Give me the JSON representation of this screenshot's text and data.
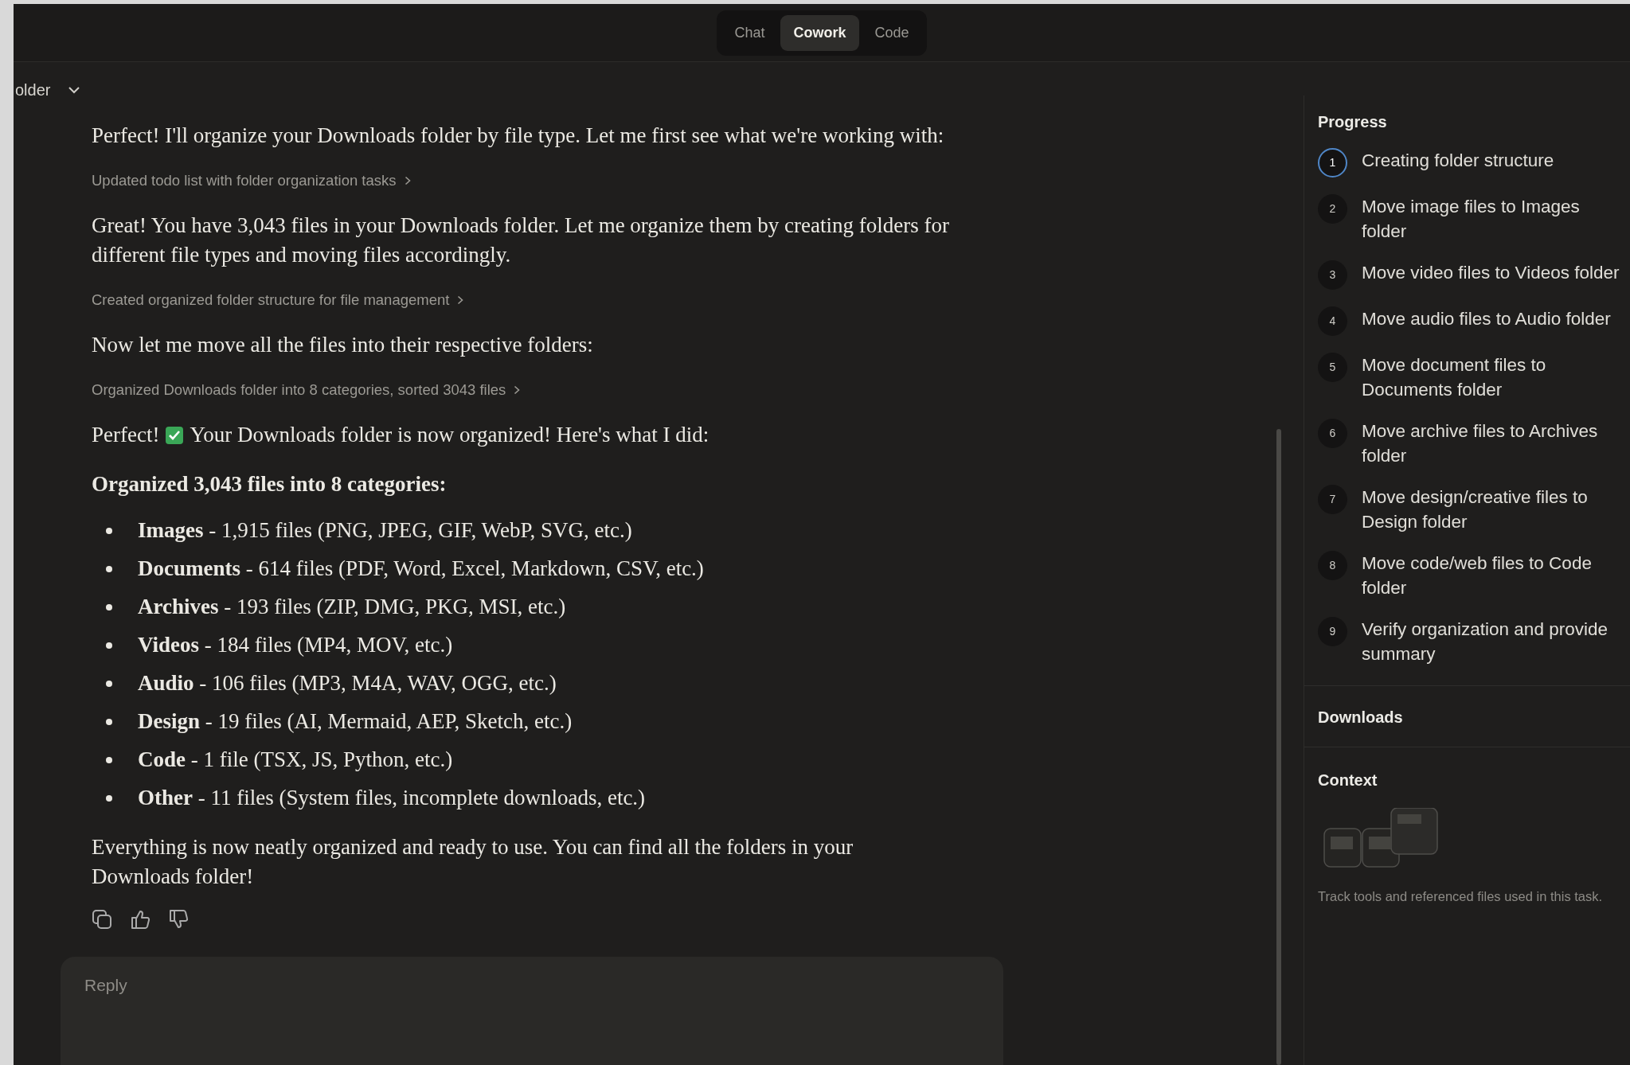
{
  "mode_tabs": [
    {
      "label": "Chat",
      "selected": false
    },
    {
      "label": "Cowork",
      "selected": true
    },
    {
      "label": "Code",
      "selected": false
    }
  ],
  "conversation": {
    "title": "older"
  },
  "messages": [
    {
      "kind": "paragraph",
      "text": "Perfect! I'll organize your Downloads folder by file type. Let me first see what we're working with:"
    },
    {
      "kind": "tool",
      "text": "Updated todo list with folder organization tasks"
    },
    {
      "kind": "paragraph",
      "text": "Great! You have 3,043 files in your Downloads folder. Let me organize them by creating folders for different file types and moving files accordingly."
    },
    {
      "kind": "tool",
      "text": "Created organized folder structure for file management"
    },
    {
      "kind": "paragraph",
      "text": "Now let me move all the files into their respective folders:"
    },
    {
      "kind": "tool",
      "text": "Organized Downloads folder into 8 categories, sorted 3043 files"
    },
    {
      "kind": "checked",
      "parts": [
        "Perfect!",
        "Your Downloads folder is now organized! Here's what I did:"
      ]
    },
    {
      "kind": "heading",
      "text": "Organized 3,043 files into 8 categories:"
    },
    {
      "kind": "bullets",
      "items": [
        "**Images** - 1,915 files (PNG, JPEG, GIF, WebP, SVG, etc.)",
        "**Documents** - 614 files (PDF, Word, Excel, Markdown, CSV, etc.)",
        "**Archives** - 193 files (ZIP, DMG, PKG, MSI, etc.)",
        "**Videos** - 184 files (MP4, MOV, etc.)",
        "**Audio** - 106 files (MP3, M4A, WAV, OGG, etc.)",
        "**Design** - 19 files (AI, Mermaid, AEP, Sketch, etc.)",
        "**Code** - 1 file (TSX, JS, Python, etc.)",
        "**Other** - 11 files (System files, incomplete downloads, etc.)"
      ]
    },
    {
      "kind": "paragraph",
      "text": "Everything is now neatly organized and ready to use. You can find all the folders in your Downloads folder!"
    }
  ],
  "reply": {
    "placeholder": "Reply"
  },
  "progress": {
    "title": "Progress",
    "steps": [
      {
        "number": "1",
        "label": "Creating folder structure",
        "active": true
      },
      {
        "number": "2",
        "label": "Move image files to Images folder",
        "active": false
      },
      {
        "number": "3",
        "label": "Move video files to Videos folder",
        "active": false
      },
      {
        "number": "4",
        "label": "Move audio files to Audio folder",
        "active": false
      },
      {
        "number": "5",
        "label": "Move document files to Documents folder",
        "active": false
      },
      {
        "number": "6",
        "label": "Move archive files to Archives folder",
        "active": false
      },
      {
        "number": "7",
        "label": "Move design/creative files to Design folder",
        "active": false
      },
      {
        "number": "8",
        "label": "Move code/web files to Code folder",
        "active": false
      },
      {
        "number": "9",
        "label": "Verify organization and provide summary",
        "active": false
      }
    ]
  },
  "downloads": {
    "title": "Downloads"
  },
  "context": {
    "title": "Context",
    "description": "Track tools and referenced files used in this task."
  }
}
